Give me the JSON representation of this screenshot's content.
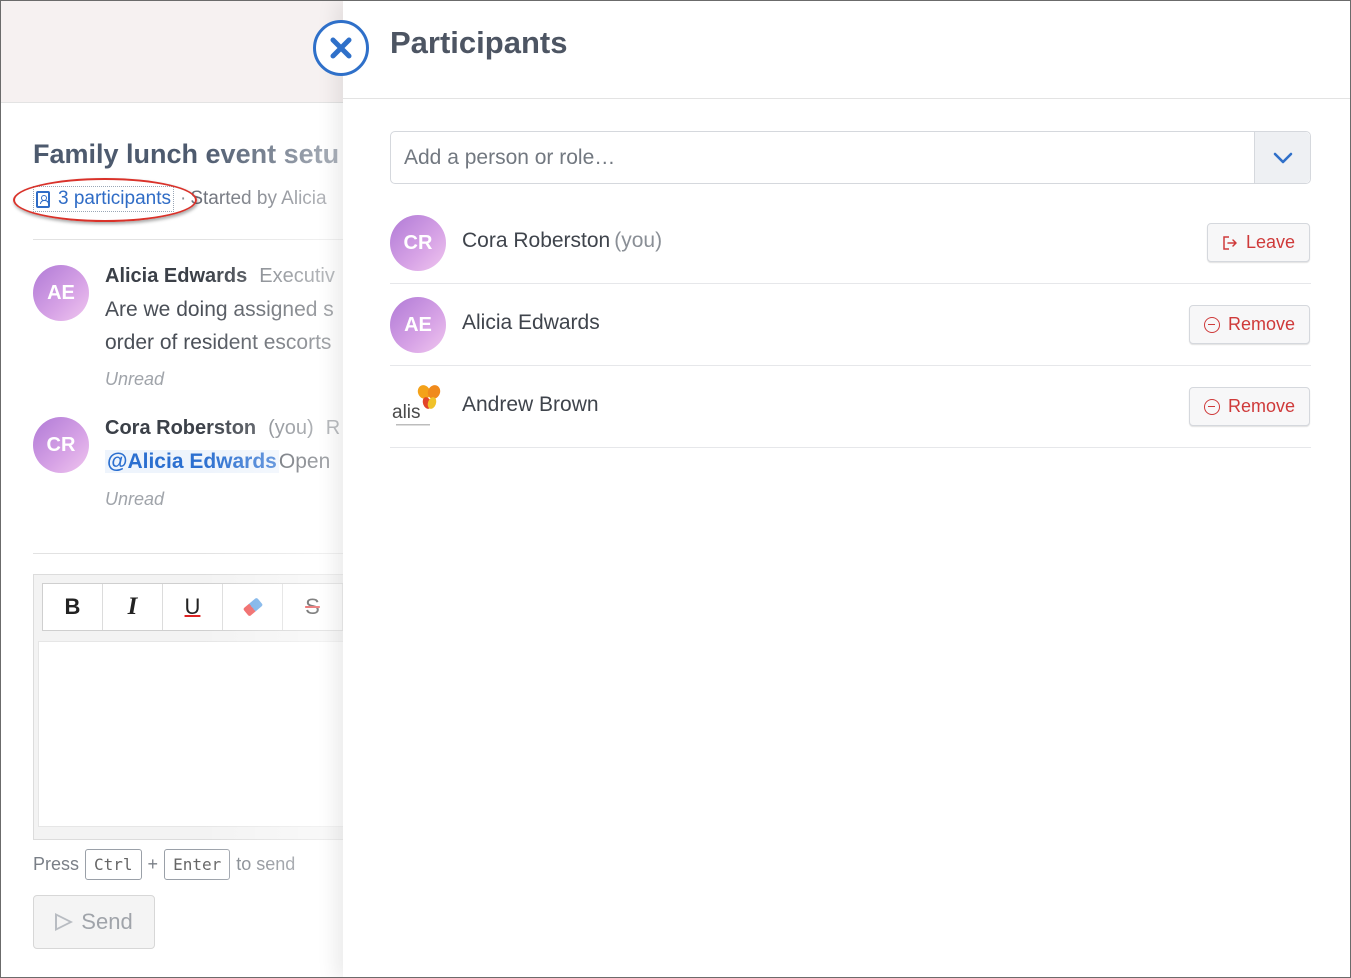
{
  "conversation": {
    "title": "Family lunch event setu",
    "participants_link": "3 participants",
    "separator": "·",
    "started_by": "Started by Alicia",
    "messages": [
      {
        "initials": "AE",
        "author": "Alicia Edwards",
        "role": "Executiv",
        "lines": [
          "Are we doing assigned s",
          "order of resident escorts"
        ],
        "status": "Unread"
      },
      {
        "initials": "CR",
        "author": "Cora Roberston",
        "you": "(you)",
        "role": "R",
        "mention": "@Alicia Edwards",
        "body_after_mention": "Open",
        "status": "Unread"
      }
    ]
  },
  "editor": {
    "toolbar": [
      "B",
      "I",
      "U",
      "eraser-icon",
      "S"
    ],
    "hint_press": "Press",
    "hint_ctrl": "Ctrl",
    "hint_plus": "+",
    "hint_enter": "Enter",
    "hint_to_send": "to send",
    "send_label": "Send"
  },
  "panel": {
    "title": "Participants",
    "search_placeholder": "Add a person or role…",
    "participants": [
      {
        "initials": "CR",
        "name": "Cora Roberston",
        "you": "(you)",
        "action": "Leave",
        "action_icon": "leave-icon"
      },
      {
        "initials": "AE",
        "name": "Alicia Edwards",
        "action": "Remove",
        "action_icon": "minus-circle-icon"
      },
      {
        "logo_text": "alis",
        "name": "Andrew Brown",
        "action": "Remove",
        "action_icon": "minus-circle-icon"
      }
    ]
  },
  "colors": {
    "accent": "#2f70c9",
    "danger": "#cf3a3a",
    "annotation": "#d9322a"
  }
}
